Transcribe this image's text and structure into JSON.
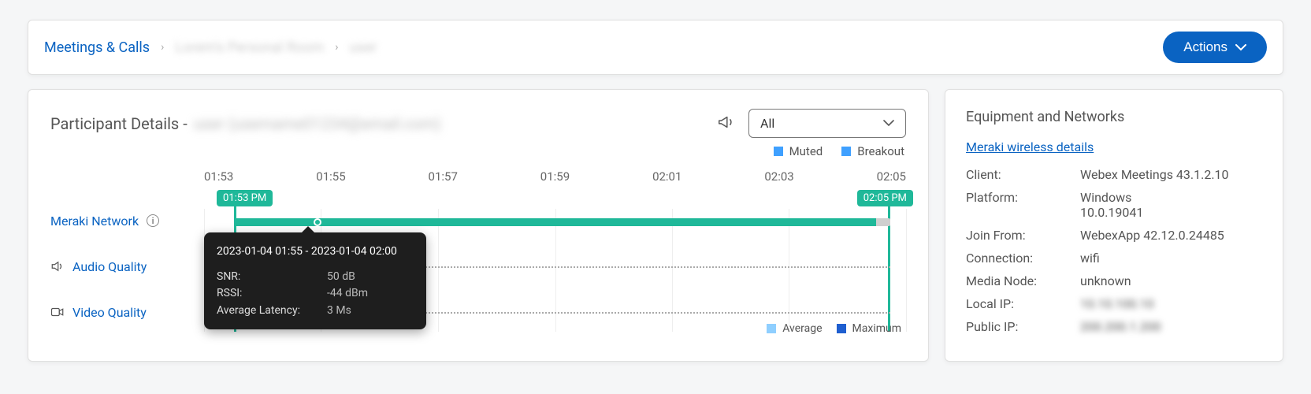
{
  "breadcrumb": {
    "root": "Meetings & Calls",
    "room": "Lorem's Personal Room",
    "extra": "user"
  },
  "actions": {
    "label": "Actions"
  },
  "main": {
    "title_prefix": "Participant Details -",
    "title_redacted": "user (username01234@email.com)",
    "filter_selected": "All",
    "legend_top": {
      "muted": "Muted",
      "breakout": "Breakout"
    },
    "legend_bottom": {
      "avg": "Average",
      "max": "Maximum"
    },
    "rows": {
      "meraki": "Meraki Network",
      "audio": "Audio Quality",
      "video": "Video Quality"
    },
    "badges": {
      "start": "01:53 PM",
      "end": "02:05 PM"
    },
    "tooltip": {
      "range": "2023-01-04 01:55 - 2023-01-04 02:00",
      "snr_k": "SNR:",
      "snr_v": "50 dB",
      "rssi_k": "RSSI:",
      "rssi_v": "-44 dBm",
      "lat_k": "Average Latency:",
      "lat_v": "3 Ms"
    }
  },
  "side": {
    "title": "Equipment and Networks",
    "link": "Meraki wireless details",
    "client_k": "Client:",
    "client_v": "Webex Meetings 43.1.2.10",
    "platform_k": "Platform:",
    "platform_v1": "Windows",
    "platform_v2": "10.0.19041",
    "join_k": "Join From:",
    "join_v": "WebexApp 42.12.0.24485",
    "conn_k": "Connection:",
    "conn_v": "wifi",
    "node_k": "Media Node:",
    "node_v": "unknown",
    "localip_k": "Local IP:",
    "localip_v": "10.10.100.10",
    "publicip_k": "Public IP:",
    "publicip_v": "200.200.1.200"
  },
  "chart_data": {
    "type": "timeline",
    "x_ticks": [
      "01:53",
      "01:55",
      "01:57",
      "01:59",
      "02:01",
      "02:03",
      "02:05"
    ],
    "tracks": [
      {
        "name": "Meraki Network",
        "start": "01:53 PM",
        "end": "02:05 PM",
        "status": "good",
        "tail_status": "unknown"
      },
      {
        "name": "Audio Quality",
        "style": "dotted",
        "data": null
      },
      {
        "name": "Video Quality",
        "style": "dotted",
        "data": null
      }
    ],
    "hover_point": {
      "time_range": "2023-01-04 01:55 - 2023-01-04 02:00",
      "snr_db": 50,
      "rssi_dbm": -44,
      "avg_latency_ms": 3
    }
  }
}
